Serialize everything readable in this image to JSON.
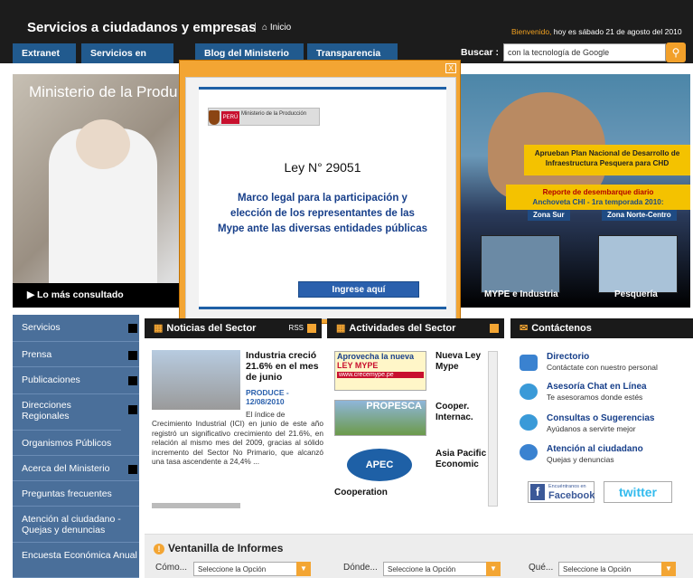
{
  "header": {
    "title": "Servicios a ciudadanos y empresas",
    "separator": "|",
    "home_link": "⌂ Inicio",
    "welcome_prefix": "Bienvenido,",
    "welcome_date": " hoy es sábado 21 de agosto del 2010"
  },
  "nav": {
    "tabs": [
      "Extranet",
      "Servicios en Linea",
      "Blog del Ministerio",
      "Transparencia"
    ]
  },
  "search": {
    "label": "Buscar :",
    "value": "con la tecnología de Google",
    "button_icon": "search-icon"
  },
  "hero": {
    "title": "Ministerio de la Produ",
    "lo_mas": "▶  Lo más consultado",
    "banner1": "Aprueban Plan Nacional de Desarrollo de Infraestructura Pesquera para CHD",
    "banner2_line1": "Reporte de desembarque diario",
    "banner2_line2": "Anchoveta CHI - 1ra temporada 2010:",
    "zona_sur": "Zona Sur",
    "zona_norte": "Zona Norte-Centro",
    "cap1": "MYPE e Industria",
    "cap2": "Pesquería"
  },
  "popup": {
    "close": "X",
    "logo_peru": "PERÚ",
    "logo_min": "Ministerio de la Producción",
    "ley": "Ley N° 29051",
    "marco": "Marco legal para la participación y elección de los representantes de las Mype ante las diversas entidades públicas",
    "button": "Ingrese aquí"
  },
  "sidebar": {
    "items": [
      "Servicios",
      "Prensa",
      "Publicaciones",
      "Direcciones Regionales",
      "Organismos Públicos",
      "Acerca del Ministerio",
      "Preguntas frecuentes",
      "Atención al ciudadano - Quejas y denuncias",
      "Encuesta Económica Anual"
    ]
  },
  "noticias": {
    "header": "Noticias del Sector",
    "rss": "RSS",
    "title": "Industria creció 21.6% en el mes de junio",
    "date_line1": "PRODUCE -",
    "date_line2": "12/08/2010",
    "el": "El    índice    de",
    "body": "Crecimiento Industrial (ICI) en junio de este año registró un significativo crecimiento del 21.6%, en relación al mismo mes del 2009, gracias al sólido incremento del Sector No Primario, que alcanzó una tasa ascendente a 24,4% ..."
  },
  "actividades": {
    "header": "Actividades del Sector",
    "items": [
      "Nueva Ley Mype",
      "Cooper. Internac.",
      "Asia Pacific Economic",
      "Cooperation"
    ],
    "img1_line1": "Aprovecha la nueva",
    "img1_line2": "LEY MYPE",
    "img1_url": "www.crecemype.pe",
    "img2": "PROPESCA",
    "img3": "APEC"
  },
  "contacto": {
    "header": "Contáctenos",
    "items": [
      {
        "title": "Directorio",
        "sub": "Contáctate con nuestro personal"
      },
      {
        "title": "Asesoría Chat en Línea",
        "sub": "Te asesoramos donde estés"
      },
      {
        "title": "Consultas o Sugerencias",
        "sub": "Ayúdanos a servirte mejor"
      },
      {
        "title": "Atención al ciudadano",
        "sub": "Quejas y denuncias"
      }
    ],
    "fb_small": "Encuéntranos en",
    "fb": "Facebook",
    "twitter": "twitter"
  },
  "ventanilla": {
    "title": "Ventanilla de Informes",
    "como": "Cómo...",
    "donde": "Dónde...",
    "que": "Qué...",
    "option": "Seleccione la Opción"
  }
}
